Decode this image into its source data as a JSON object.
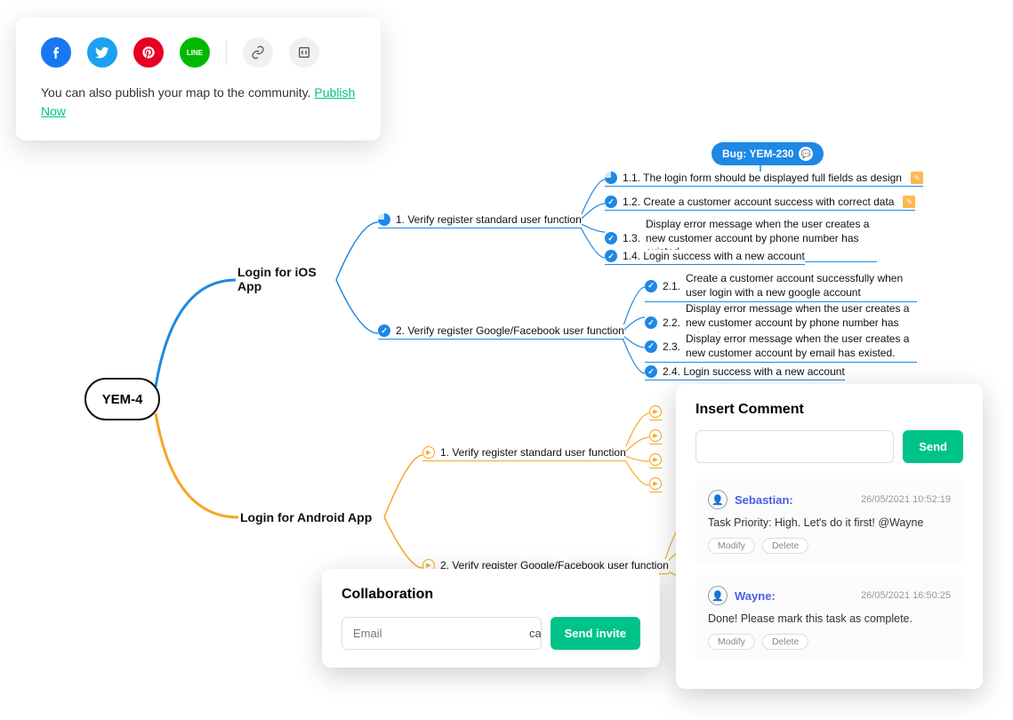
{
  "share": {
    "publish_text": "You can also publish your map to the community. ",
    "publish_link": "Publish Now"
  },
  "mindmap": {
    "root": "YEM-4",
    "branch_ios": "Login for iOS App",
    "branch_android": "Login for Android App",
    "bug_tag": "Bug: YEM-230",
    "ios": {
      "n1": "1. Verify register standard user function",
      "n1_1": "1.1. The login form should be displayed full fields as design",
      "n1_2": "1.2. Create a customer account success with correct data",
      "n1_3_num": "1.3.",
      "n1_3": "Display error message when the user creates a new customer account by phone number has existed.",
      "n1_4": "1.4. Login success with a new account",
      "n2": "2. Verify register Google/Facebook user function",
      "n2_1_num": "2.1.",
      "n2_1": "Create a customer account successfully when user login with a new google account",
      "n2_2_num": "2.2.",
      "n2_2": "Display error message when the user creates a new customer account by phone number has existed.",
      "n2_3_num": "2.3.",
      "n2_3": "Display error message when the user creates a new customer account by email has existed.",
      "n2_4": "2.4. Login success with a new account"
    },
    "android": {
      "n1": "1. Verify register standard user function",
      "n2": "2. Verify register Google/Facebook user function"
    }
  },
  "collab": {
    "title": "Collaboration",
    "email_placeholder": "Email",
    "perm": "can view",
    "send_btn": "Send invite"
  },
  "comments": {
    "title": "Insert Comment",
    "send_btn": "Send",
    "items": [
      {
        "name": "Sebastian:",
        "time": "26/05/2021 10:52:19",
        "body": "Task Priority: High. Let's do it first! @Wayne"
      },
      {
        "name": "Wayne:",
        "time": "26/05/2021 16:50:25",
        "body": "Done! Please mark this task as complete."
      }
    ],
    "modify": "Modify",
    "delete": "Delete"
  }
}
